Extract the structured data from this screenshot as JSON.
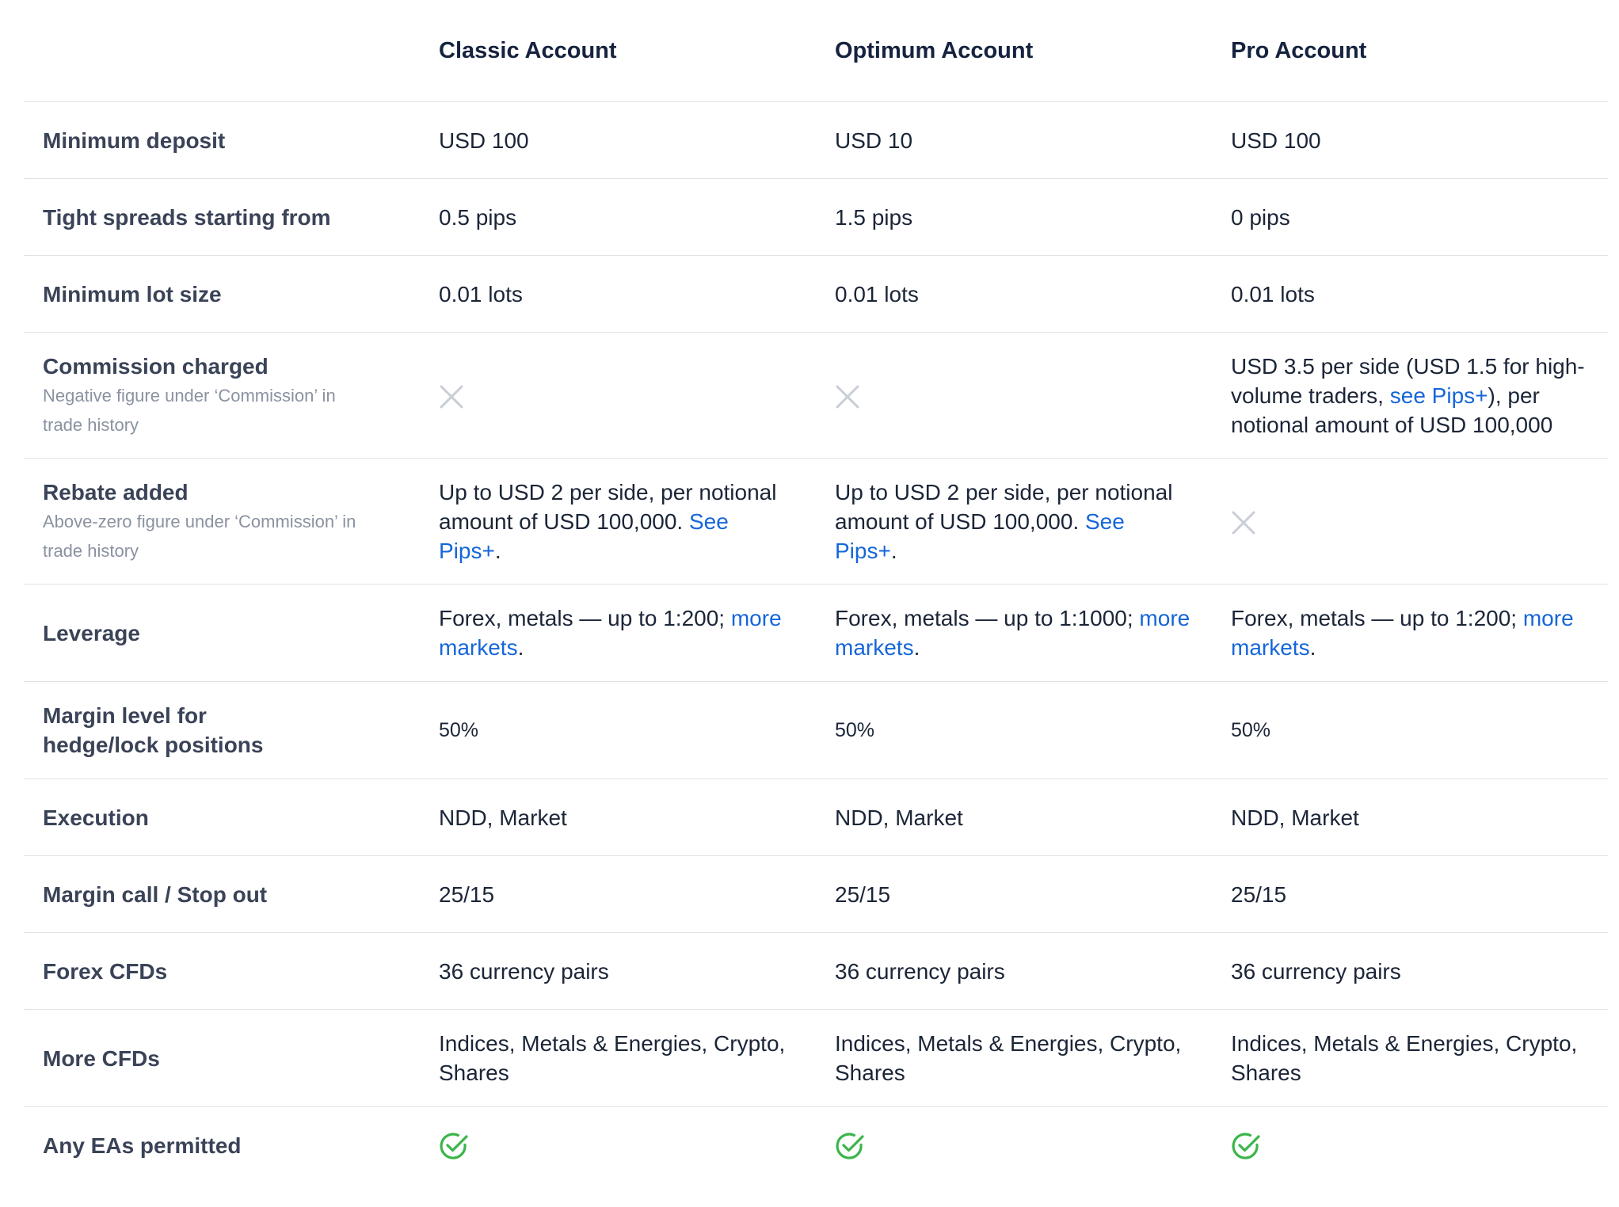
{
  "header": {
    "columns": [
      "",
      "Classic Account",
      "Optimum Account",
      "Pro Account"
    ]
  },
  "rows": {
    "min_deposit": {
      "label": "Minimum deposit",
      "values": [
        "USD 100",
        "USD 10",
        "USD 100"
      ]
    },
    "spreads": {
      "label": "Tight spreads starting from",
      "values": [
        "0.5 pips",
        "1.5 pips",
        "0 pips"
      ]
    },
    "lot_size": {
      "label": "Minimum lot size",
      "values": [
        "0.01 lots",
        "0.01 lots",
        "0.01 lots"
      ]
    },
    "commission": {
      "label": "Commission charged",
      "sublabel": "Negative figure under ‘Commission’ in trade history",
      "classic_icon": "cross-icon",
      "optimum_icon": "cross-icon",
      "pro": {
        "text_before": "USD 3.5 per side (USD 1.5 for high-volume traders, ",
        "link": "see Pips+",
        "text_after": "), per notional amount of USD 100,000"
      }
    },
    "rebate": {
      "label": "Rebate added",
      "sublabel": "Above-zero figure under ‘Commission’ in trade history",
      "classic": {
        "text_before": "Up to USD 2 per side, per notional amount of USD 100,000. ",
        "link": "See Pips+",
        "text_after": "."
      },
      "optimum": {
        "text_before": "Up to USD 2 per side, per notional amount of USD 100,000. ",
        "link": "See Pips+",
        "text_after": "."
      },
      "pro_icon": "cross-icon"
    },
    "leverage": {
      "label": "Leverage",
      "classic": {
        "text_before": "Forex, metals — up to 1:200; ",
        "link": "more markets",
        "text_after": "."
      },
      "optimum": {
        "text_before": "Forex, metals — up to 1:1000; ",
        "link": "more markets",
        "text_after": "."
      },
      "pro": {
        "text_before": "Forex, metals — up to 1:200; ",
        "link": "more markets",
        "text_after": "."
      }
    },
    "margin_hedge": {
      "label": "Margin level for hedge/lock positions",
      "values": [
        "50%",
        "50%",
        "50%"
      ]
    },
    "execution": {
      "label": "Execution",
      "values": [
        "NDD, Market",
        "NDD, Market",
        "NDD, Market"
      ]
    },
    "margin_call": {
      "label": "Margin call / Stop out",
      "values": [
        "25/15",
        "25/15",
        "25/15"
      ]
    },
    "forex_cfds": {
      "label": "Forex CFDs",
      "values": [
        "36 currency pairs",
        "36 currency pairs",
        "36 currency pairs"
      ]
    },
    "more_cfds": {
      "label": "More CFDs",
      "values": [
        "Indices, Metals & Energies, Crypto, Shares",
        "Indices, Metals & Energies, Crypto, Shares",
        "Indices, Metals & Energies, Crypto, Shares"
      ]
    },
    "eas": {
      "label": "Any EAs permitted",
      "icons": [
        "check-circle-icon",
        "check-circle-icon",
        "check-circle-icon"
      ]
    }
  },
  "colors": {
    "link": "#1566d9",
    "check": "#3bb54a",
    "cross": "#c9ced6",
    "divider": "#dfe3e8",
    "label": "#3a4357",
    "sublabel": "#8a92a1"
  }
}
